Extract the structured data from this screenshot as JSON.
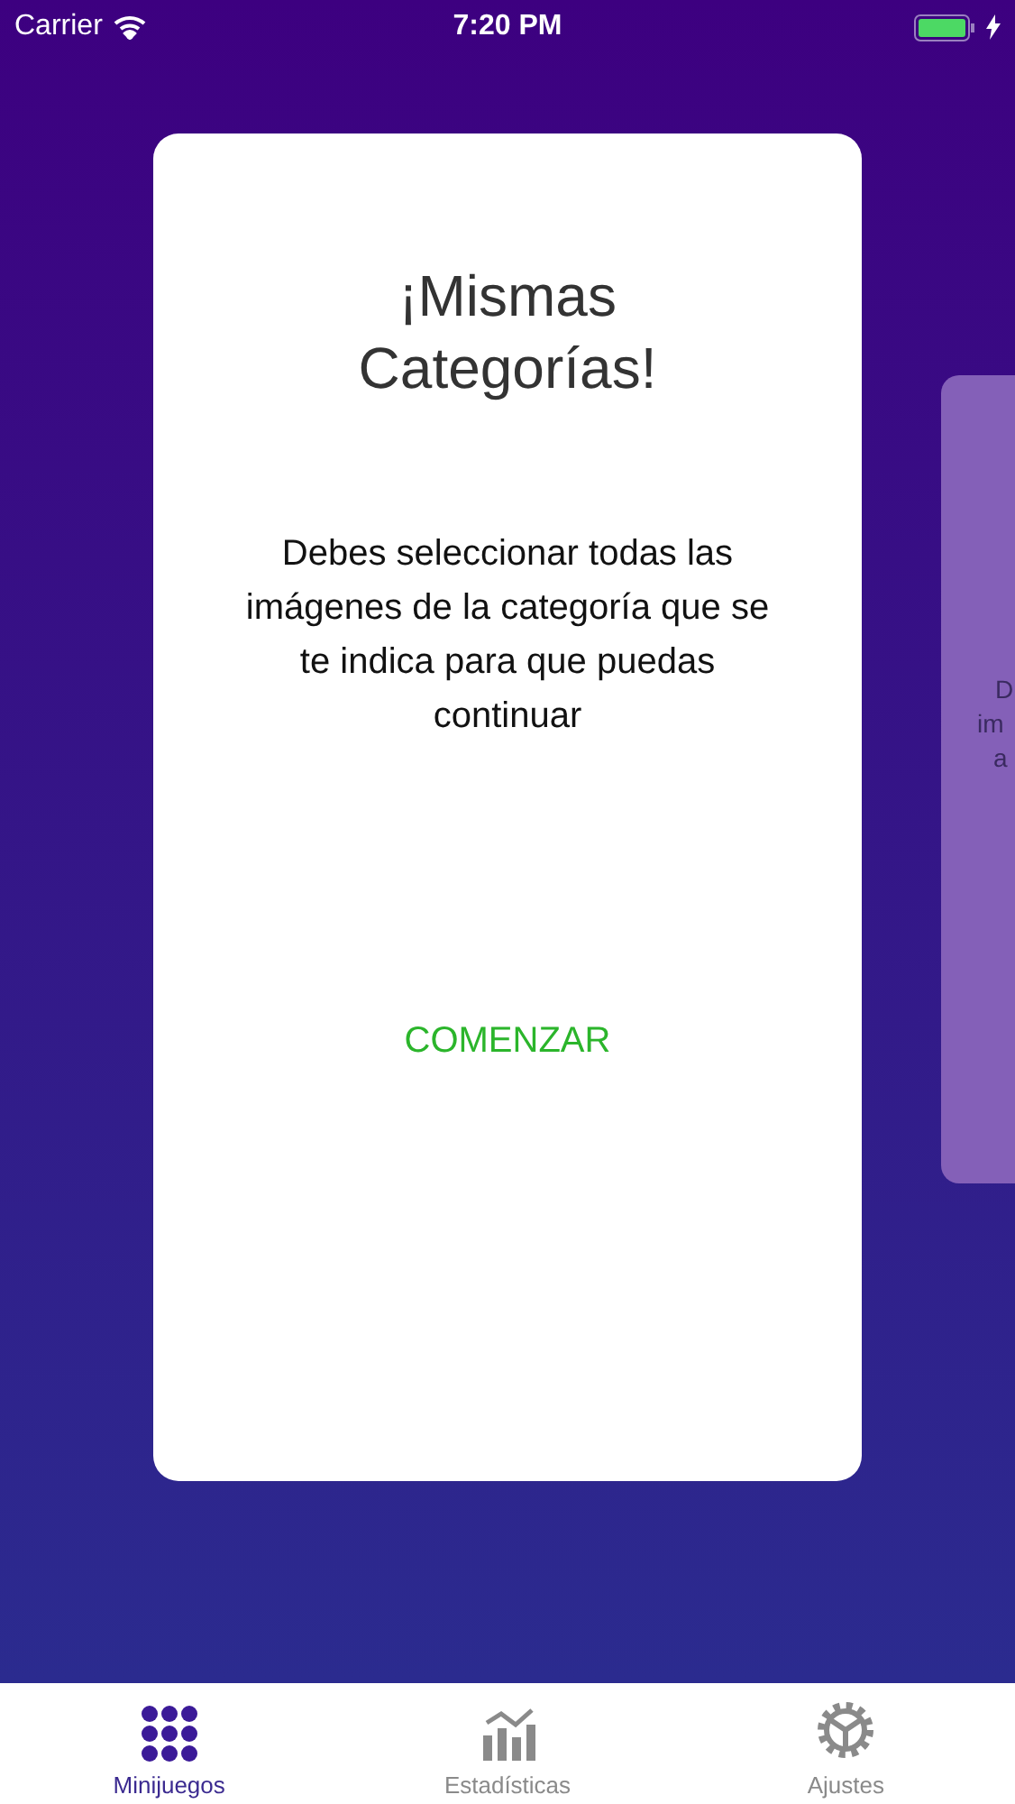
{
  "status_bar": {
    "carrier": "Carrier",
    "time": "7:20 PM",
    "charging": true
  },
  "cards": [
    {
      "kind": "full",
      "title": "¡Mismas Categorías!",
      "description": "Debes seleccionar todas las imágenes de la categoría que se te indica para que puedas continuar",
      "action": "COMENZAR"
    },
    {
      "kind": "peek",
      "lines": [
        "D",
        "im",
        "a"
      ]
    }
  ],
  "tab_bar": [
    {
      "label": "Minijuegos",
      "kind": "dots",
      "selected": true
    },
    {
      "label": "Estadísticas",
      "kind": "chart",
      "selected": false
    },
    {
      "label": "Ajustes",
      "kind": "gear",
      "selected": false
    }
  ]
}
